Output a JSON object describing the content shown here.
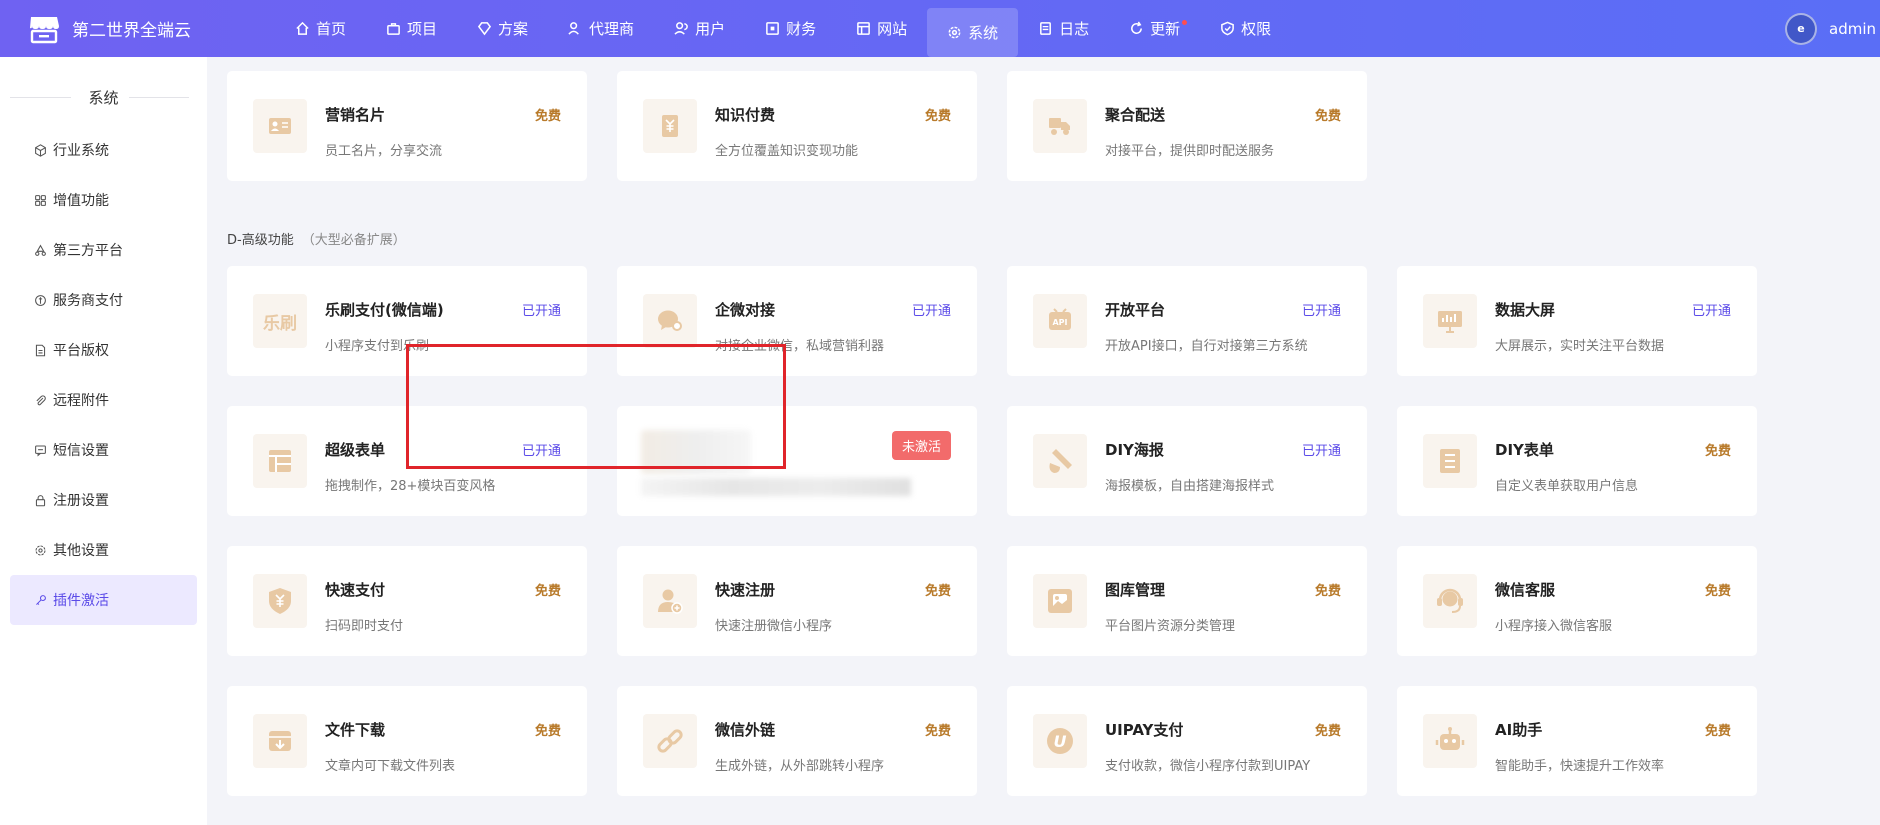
{
  "brand": {
    "name": "第二世界全端云"
  },
  "nav": [
    {
      "label": "首页",
      "icon": "home-icon"
    },
    {
      "label": "项目",
      "icon": "briefcase-icon"
    },
    {
      "label": "方案",
      "icon": "diamond-icon"
    },
    {
      "label": "代理商",
      "icon": "users-icon"
    },
    {
      "label": "用户",
      "icon": "user-group-icon"
    },
    {
      "label": "财务",
      "icon": "wallet-icon"
    },
    {
      "label": "网站",
      "icon": "window-icon"
    },
    {
      "label": "系统",
      "icon": "gear-icon",
      "active": true
    },
    {
      "label": "日志",
      "icon": "log-icon"
    },
    {
      "label": "更新",
      "icon": "refresh-icon",
      "dot": true
    },
    {
      "label": "权限",
      "icon": "shield-icon"
    }
  ],
  "user": {
    "name": "admin",
    "avatar_text": "e"
  },
  "sidebar": {
    "title": "系统",
    "items": [
      {
        "label": "行业系统",
        "icon": "cube-icon"
      },
      {
        "label": "增值功能",
        "icon": "grid-icon"
      },
      {
        "label": "第三方平台",
        "icon": "recycle-icon"
      },
      {
        "label": "服务商支付",
        "icon": "coin-icon"
      },
      {
        "label": "平台版权",
        "icon": "document-icon"
      },
      {
        "label": "远程附件",
        "icon": "paperclip-icon"
      },
      {
        "label": "短信设置",
        "icon": "message-icon"
      },
      {
        "label": "注册设置",
        "icon": "lock-icon"
      },
      {
        "label": "其他设置",
        "icon": "settings-icon"
      },
      {
        "label": "插件激活",
        "icon": "key-icon",
        "active": true
      }
    ]
  },
  "section": {
    "title": "D-高级功能",
    "subtitle": "（大型必备扩展）"
  },
  "top_row": [
    {
      "title": "营销名片",
      "desc": "员工名片，分享交流",
      "status": "免费",
      "icon": "business-card-icon"
    },
    {
      "title": "知识付费",
      "desc": "全方位覆盖知识变现功能",
      "status": "免费",
      "icon": "knowledge-icon"
    },
    {
      "title": "聚合配送",
      "desc": "对接平台，提供即时配送服务",
      "status": "免费",
      "icon": "delivery-icon"
    }
  ],
  "grid": [
    {
      "title": "乐刷支付(微信端)",
      "desc": "小程序支付到乐刷",
      "status": "已开通",
      "icon": "leshua-icon",
      "icon_text": "乐刷"
    },
    {
      "title": "企微对接",
      "desc": "对接企业微信，私域营销利器",
      "status": "已开通",
      "icon": "wecom-icon"
    },
    {
      "title": "开放平台",
      "desc": "开放API接口，自行对接第三方系统",
      "status": "已开通",
      "icon": "api-icon"
    },
    {
      "title": "数据大屏",
      "desc": "大屏展示，实时关注平台数据",
      "status": "已开通",
      "icon": "monitor-icon"
    },
    {
      "title": "超级表单",
      "desc": "拖拽制作，28+模块百变风格",
      "status": "已开通",
      "icon": "form-icon"
    },
    {
      "blurred": true,
      "status": "未激活"
    },
    {
      "title": "DIY海报",
      "desc": "海报模板，自由搭建海报样式",
      "status": "已开通",
      "icon": "brush-icon"
    },
    {
      "title": "DIY表单",
      "desc": "自定义表单获取用户信息",
      "status": "免费",
      "icon": "list-icon"
    },
    {
      "title": "快速支付",
      "desc": "扫码即时支付",
      "status": "免费",
      "icon": "shield-yen-icon"
    },
    {
      "title": "快速注册",
      "desc": "快速注册微信小程序",
      "status": "免费",
      "icon": "user-add-icon"
    },
    {
      "title": "图库管理",
      "desc": "平台图片资源分类管理",
      "status": "免费",
      "icon": "gallery-icon"
    },
    {
      "title": "微信客服",
      "desc": "小程序接入微信客服",
      "status": "免费",
      "icon": "headset-icon"
    },
    {
      "title": "文件下载",
      "desc": "文章内可下载文件列表",
      "status": "免费",
      "icon": "download-box-icon"
    },
    {
      "title": "微信外链",
      "desc": "生成外链，从外部跳转小程序",
      "status": "免费",
      "icon": "link-icon"
    },
    {
      "title": "UIPAY支付",
      "desc": "支付收款，微信小程序付款到UIPAY",
      "status": "免费",
      "icon": "uipay-icon",
      "icon_text": "U"
    },
    {
      "title": "AI助手",
      "desc": "智能助手，快速提升工作效率",
      "status": "免费",
      "icon": "robot-icon"
    }
  ],
  "colors": {
    "accent": "#5b4be8",
    "free": "#b87a2a",
    "icon": "#e8c9a4",
    "alert": "#f26b6b",
    "highlight": "#e0242a"
  }
}
